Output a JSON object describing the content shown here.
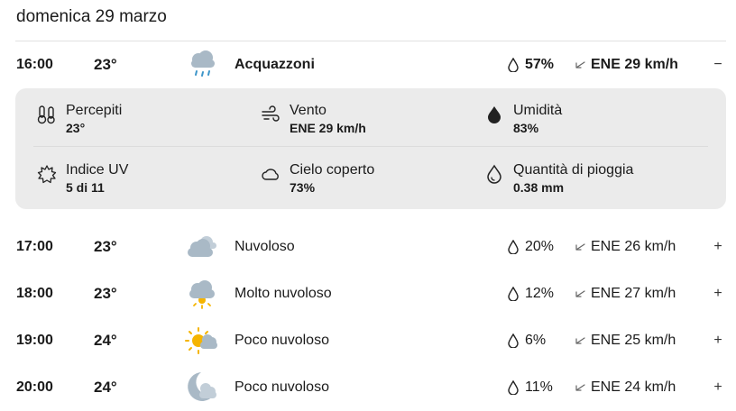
{
  "day": {
    "title": "domenica 29 marzo"
  },
  "hours": [
    {
      "time": "16:00",
      "temp": "23°",
      "icon": "showers-icon",
      "condition": "Acquazzoni",
      "precip": "57%",
      "wind": "ENE 29 km/h",
      "toggle": "−",
      "expanded": true
    },
    {
      "time": "17:00",
      "temp": "23°",
      "icon": "cloudy-icon",
      "condition": "Nuvoloso",
      "precip": "20%",
      "wind": "ENE 26 km/h",
      "toggle": "+"
    },
    {
      "time": "18:00",
      "temp": "23°",
      "icon": "mostly-cloudy-icon",
      "condition": "Molto nuvoloso",
      "precip": "12%",
      "wind": "ENE 27 km/h",
      "toggle": "+"
    },
    {
      "time": "19:00",
      "temp": "24°",
      "icon": "partly-cloudy-day-icon",
      "condition": "Poco nuvoloso",
      "precip": "6%",
      "wind": "ENE 25 km/h",
      "toggle": "+"
    },
    {
      "time": "20:00",
      "temp": "24°",
      "icon": "partly-cloudy-night-icon",
      "condition": "Poco nuvoloso",
      "precip": "11%",
      "wind": "ENE 24 km/h",
      "toggle": "+"
    }
  ],
  "details": {
    "feels_like": {
      "label": "Percepiti",
      "value": "23°",
      "icon": "thermometer-icon"
    },
    "wind": {
      "label": "Vento",
      "value": "ENE 29 km/h",
      "icon": "wind-icon"
    },
    "humidity": {
      "label": "Umidità",
      "value": "83%",
      "icon": "humidity-drop-icon"
    },
    "uv": {
      "label": "Indice UV",
      "value": "5 di 11",
      "icon": "sun-outline-icon"
    },
    "cloud_cover": {
      "label": "Cielo coperto",
      "value": "73%",
      "icon": "cloud-outline-icon"
    },
    "rain_amount": {
      "label": "Quantità di pioggia",
      "value": "0.38 mm",
      "icon": "rain-drop-icon"
    }
  },
  "colors": {
    "cloud": "#a9b9c6",
    "sun": "#f5b400",
    "rain": "#3c95c9",
    "panel": "#ebebeb"
  }
}
